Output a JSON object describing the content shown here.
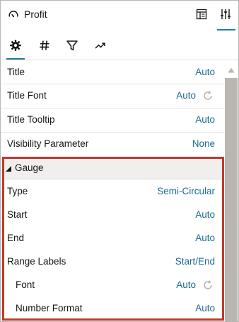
{
  "header": {
    "title": "Profit",
    "icons": [
      "gauge-icon",
      "layout-icon",
      "properties-icon"
    ]
  },
  "tabs": [
    {
      "name": "general",
      "icon": "gear-icon",
      "active": true
    },
    {
      "name": "values",
      "icon": "hash-icon",
      "active": false
    },
    {
      "name": "filter",
      "icon": "filter-icon",
      "active": false
    },
    {
      "name": "analytics",
      "icon": "trend-icon",
      "active": false
    }
  ],
  "properties": [
    {
      "label": "Title",
      "value": "Auto"
    },
    {
      "label": "Title Font",
      "value": "Auto",
      "reset": true
    },
    {
      "label": "Title Tooltip",
      "value": "Auto"
    },
    {
      "label": "Visibility Parameter",
      "value": "None"
    }
  ],
  "gauge_section": {
    "label": "Gauge",
    "expanded": true,
    "rows": [
      {
        "label": "Type",
        "value": "Semi-Circular"
      },
      {
        "label": "Start",
        "value": "Auto"
      },
      {
        "label": "End",
        "value": "Auto"
      },
      {
        "label": "Range Labels",
        "value": "Start/End"
      },
      {
        "label": "Font",
        "value": "Auto",
        "reset": true,
        "indent": true
      },
      {
        "label": "Number Format",
        "value": "Auto",
        "indent": true
      }
    ]
  },
  "colors": {
    "accent": "#227e9e",
    "value_text": "#1b6a8e",
    "highlight_border": "#c0392b",
    "scroll_thumb": "#b9b6b1"
  }
}
